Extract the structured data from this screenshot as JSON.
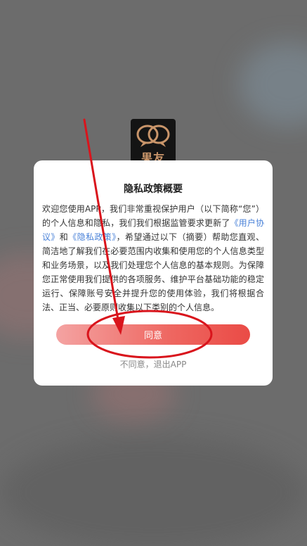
{
  "app": {
    "logo_text": "果友"
  },
  "dialog": {
    "title": "隐私政策概要",
    "body_part1": "欢迎您使用APP，我们非常重视保护用户（以下简称“您”）的个人信息和隐私，我们我们根据监管要求更新了",
    "link_user_agreement": "《用户协议》",
    "body_and": "和",
    "link_privacy_policy": "《隐私政策》",
    "body_part2": "，希望通过以下（摘要）帮助您直观、简洁地了解我们在必要范围内收集和使用您的个人信息类型和业务场景，以及我们处理您个人信息的基本规则。为保障您正常使用我们提供的各项服务、维护平台基础功能的稳定运行、保障账号安全并提升您的使用体验，我们将根据合法、正当、必要原则收集以下类别的个人信息。",
    "agree_label": "同意",
    "disagree_label": "不同意，退出APP"
  },
  "colors": {
    "link": "#4a82d8",
    "agree_gradient_start": "#f4a3a2",
    "agree_gradient_end": "#ea4b46",
    "annotation_red": "#d9141c"
  }
}
